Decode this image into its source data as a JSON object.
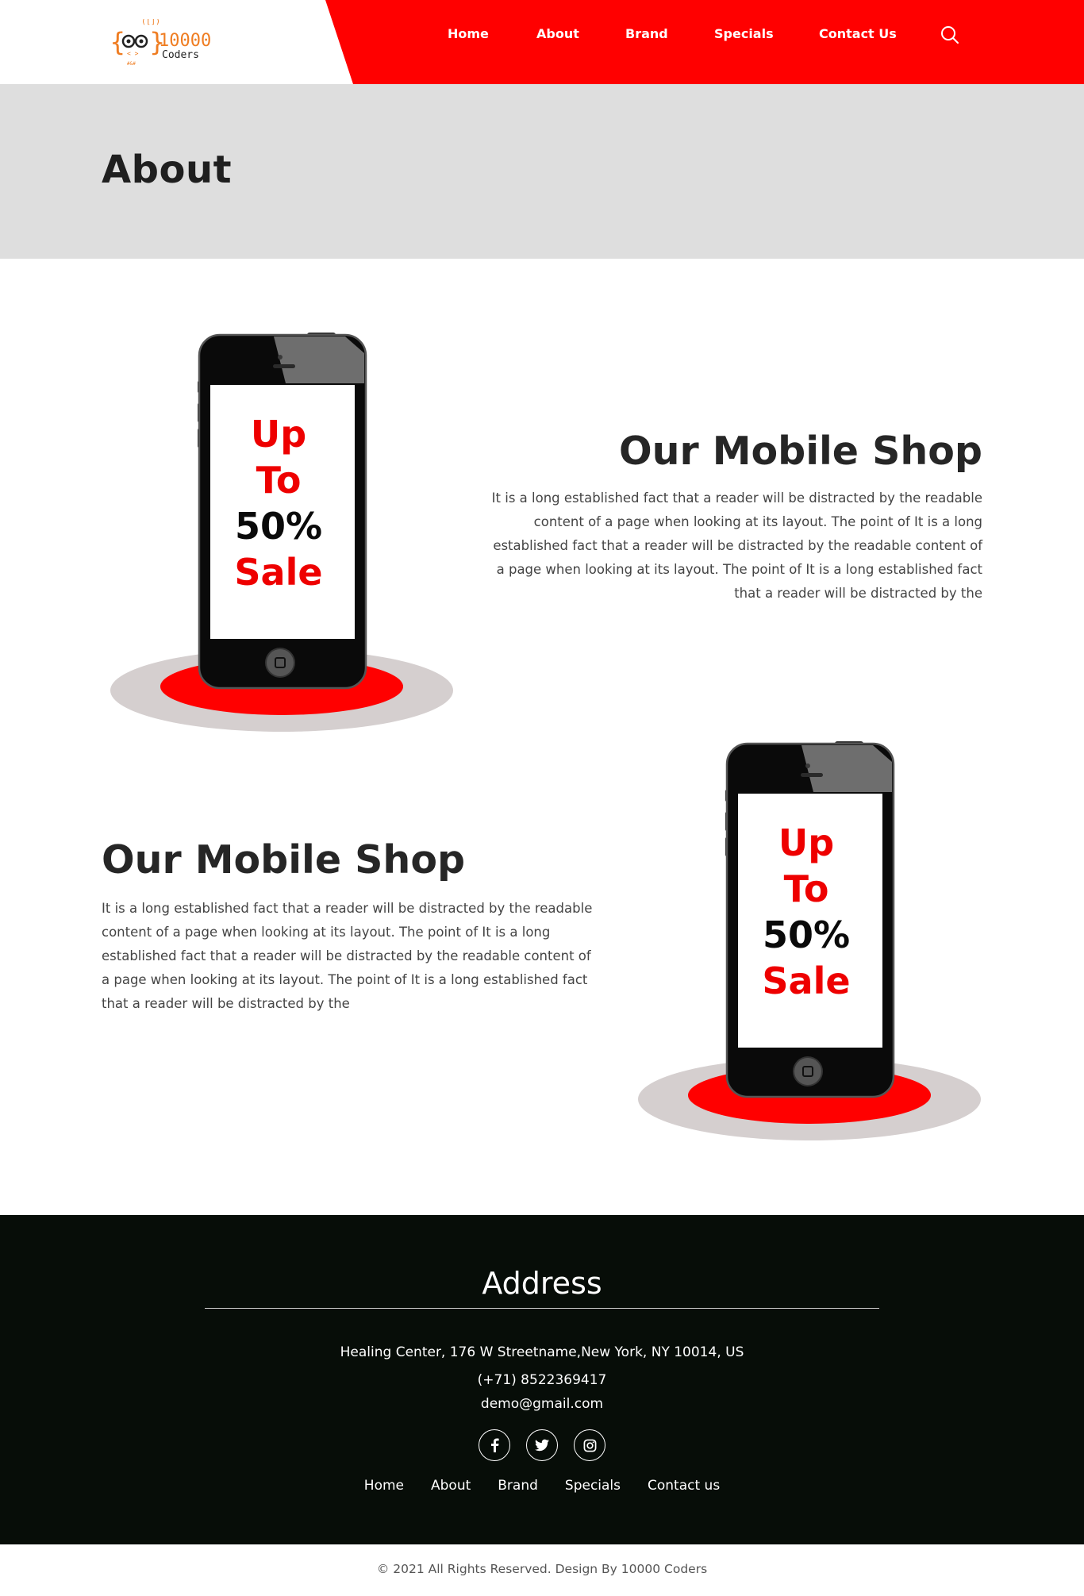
{
  "header": {
    "logo_text_top": "10000",
    "logo_text_bottom": "Coders",
    "nav": [
      "Home",
      "About",
      "Brand",
      "Specials",
      "Contact Us"
    ],
    "accent_color": "#ff0000"
  },
  "banner": {
    "title": "About"
  },
  "sections": [
    {
      "title": "Our Mobile Shop",
      "text": "It is a long established fact that a reader will be distracted by the readable content of a page when looking at its layout. The point of It is a long established fact that a reader will be distracted by the readable content of a page when looking at its layout. The point of It is a long established fact that a reader will be distracted by the",
      "sale": [
        "Up",
        "To",
        "50%",
        "Sale"
      ]
    },
    {
      "title": "Our Mobile Shop",
      "text": "It is a long established fact that a reader will be distracted by the readable content of a page when looking at its layout. The point of It is a long established fact that a reader will be distracted by the readable content of a page when looking at its layout. The point of It is a long established fact that a reader will be distracted by the",
      "sale": [
        "Up",
        "To",
        "50%",
        "Sale"
      ]
    }
  ],
  "footer": {
    "title": "Address",
    "address": "Healing Center, 176 W Streetname,New York, NY 10014, US",
    "phone": "(+71) 8522369417",
    "email": "demo@gmail.com",
    "socials": [
      "facebook-icon",
      "twitter-icon",
      "instagram-icon"
    ],
    "nav": [
      "Home",
      "About",
      "Brand",
      "Specials",
      "Contact us"
    ]
  },
  "copyright": "© 2021 All Rights Reserved. Design By 10000 Coders"
}
